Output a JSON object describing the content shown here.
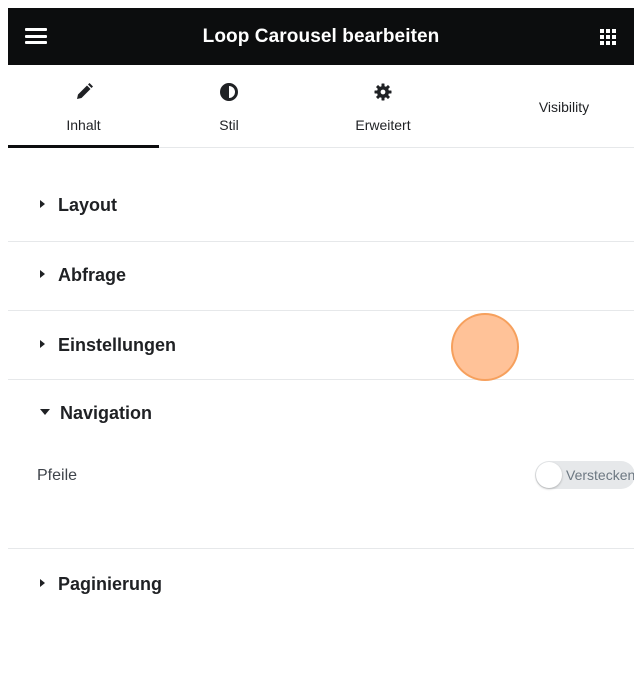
{
  "header": {
    "title": "Loop Carousel bearbeiten",
    "menu_icon": "hamburger-icon",
    "apps_icon": "grid-icon"
  },
  "tabs": [
    {
      "label": "Inhalt",
      "icon": "pencil-icon",
      "active": true
    },
    {
      "label": "Stil",
      "icon": "contrast-icon",
      "active": false
    },
    {
      "label": "Erweitert",
      "icon": "gear-icon",
      "active": false
    },
    {
      "label": "Visibility",
      "icon": "",
      "active": false
    }
  ],
  "sections": {
    "layout": {
      "label": "Layout",
      "expanded": false
    },
    "abfrage": {
      "label": "Abfrage",
      "expanded": false
    },
    "einstellungen": {
      "label": "Einstellungen",
      "expanded": false
    },
    "navigation": {
      "label": "Navigation",
      "expanded": true,
      "controls": {
        "pfeile": {
          "label": "Pfeile",
          "switch_label": "Verstecken",
          "enabled": false
        }
      }
    },
    "paginierung": {
      "label": "Paginierung",
      "expanded": false
    }
  },
  "colors": {
    "header_bg": "#0c0d0e",
    "text": "#1f2124",
    "divider": "#e6e8ea",
    "highlight": "#ffb786"
  }
}
